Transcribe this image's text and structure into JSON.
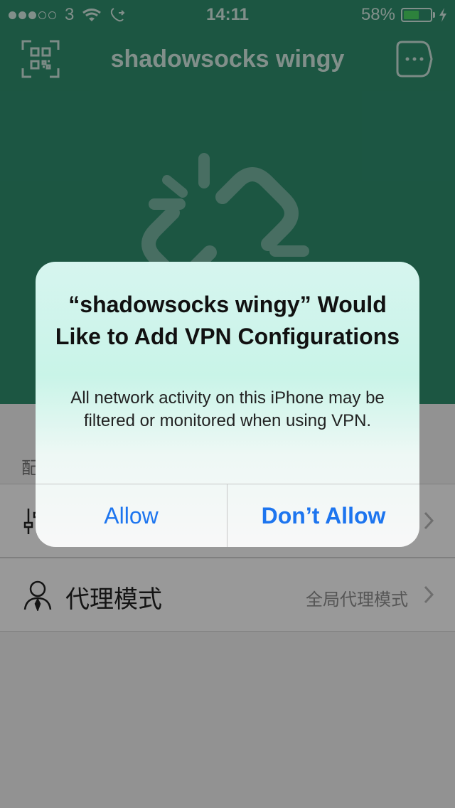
{
  "status_bar": {
    "carrier": "3",
    "time": "14:11",
    "battery_percent_text": "58%",
    "battery_level": 0.58,
    "signal_strength": 3
  },
  "nav": {
    "title": "shadowsocks wingy",
    "left_icon": "qr-scan-icon",
    "right_icon": "chat-bubble-icon"
  },
  "main": {
    "status_icon": "broken-link-icon",
    "section_header_partial": "配"
  },
  "settings": {
    "rows": [
      {
        "icon": "sliders-icon",
        "label": "",
        "value": ""
      },
      {
        "icon": "person-icon",
        "label": "代理模式",
        "value": "全局代理模式"
      }
    ]
  },
  "alert": {
    "title": "“shadowsocks wingy” Would Like to Add VPN Configurations",
    "message": "All network activity on this iPhone may be filtered or monitored when using VPN.",
    "allow_label": "Allow",
    "deny_label": "Don’t Allow"
  },
  "colors": {
    "header_green": "#2f8f6f",
    "accent_blue": "#1d75ef",
    "battery_green": "#4cd964"
  }
}
